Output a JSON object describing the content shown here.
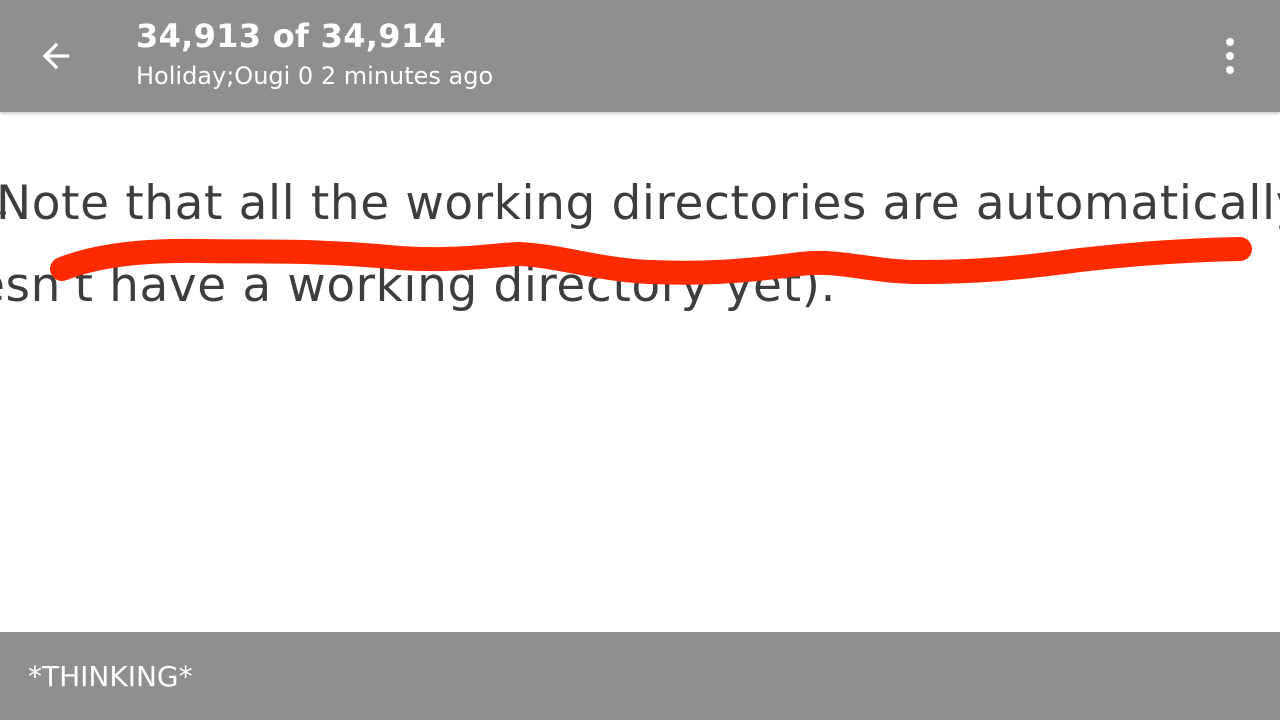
{
  "header": {
    "title": "34,913 of 34,914",
    "subtitle": "Holiday;Ougi 0 2 minutes ago",
    "back_icon": "arrow-left-icon",
    "menu_icon": "more-vertical-icon"
  },
  "image": {
    "line1": "Note that all the working directories are automatically",
    "line2": "esn't have a working directory yet).",
    "mark_color": "#ff2a00"
  },
  "footer": {
    "caption": "*THINKING*"
  },
  "colors": {
    "bar": "#8f8f8f",
    "bar_text": "#ffffff",
    "text": "#3d3d3d"
  }
}
